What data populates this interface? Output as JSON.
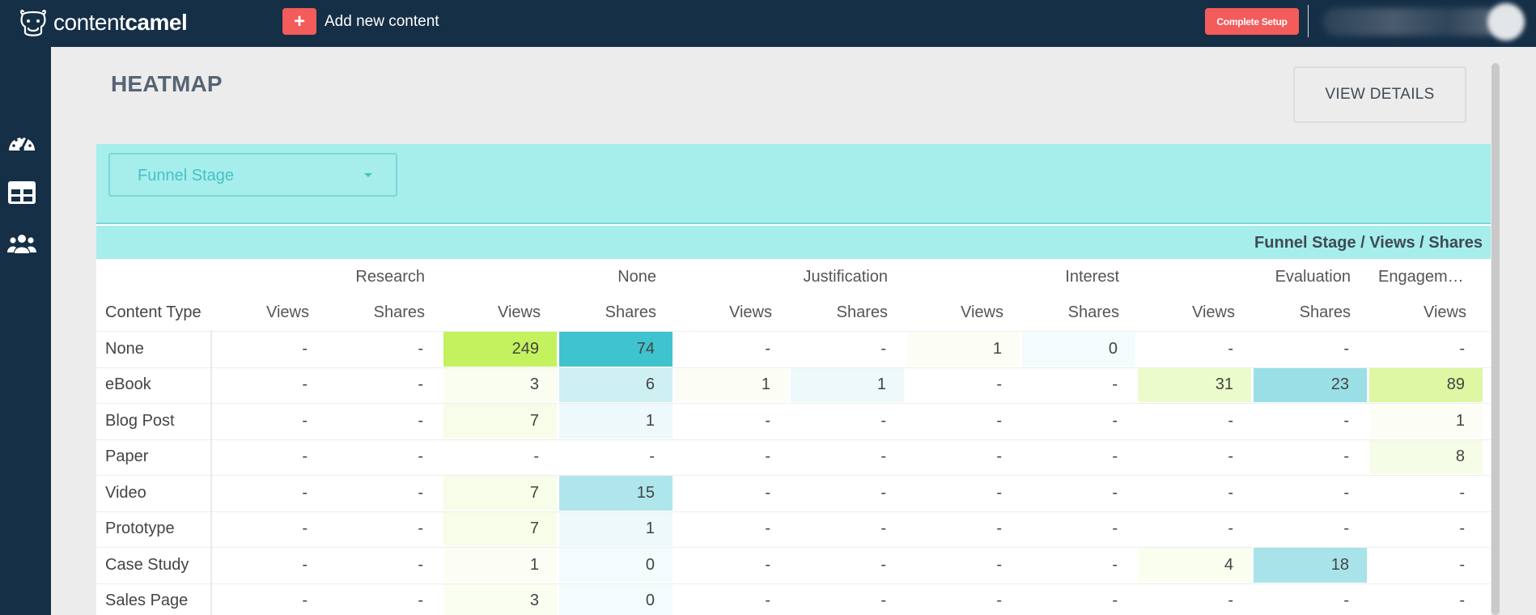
{
  "app": {
    "logo_text_light": "content",
    "logo_text_bold": "camel"
  },
  "topbar": {
    "add_label": "Add new content",
    "add_icon": "+",
    "setup_label": "Complete Setup"
  },
  "sidebar": {
    "items": [
      {
        "icon": "dashboard-gauge-icon"
      },
      {
        "icon": "table-icon"
      },
      {
        "icon": "users-icon"
      }
    ]
  },
  "page": {
    "title": "HEATMAP",
    "view_details": "VIEW DETAILS"
  },
  "filter": {
    "selected": "Funnel Stage"
  },
  "heatmap": {
    "caption": "Funnel Stage / Views / Shares",
    "row_header": "Content Type",
    "stages": [
      "Research",
      "None",
      "Justification",
      "Interest",
      "Evaluation",
      "Engagem…"
    ],
    "metrics": [
      "Views",
      "Shares",
      "Views",
      "Shares",
      "Views",
      "Shares",
      "Views",
      "Shares",
      "Views",
      "Shares",
      "Views"
    ],
    "rows": [
      {
        "label": "None",
        "values": [
          "-",
          "-",
          "249",
          "74",
          "-",
          "-",
          "1",
          "0",
          "-",
          "-",
          "-"
        ]
      },
      {
        "label": "eBook",
        "values": [
          "-",
          "-",
          "3",
          "6",
          "1",
          "1",
          "-",
          "-",
          "31",
          "23",
          "89"
        ]
      },
      {
        "label": "Blog Post",
        "values": [
          "-",
          "-",
          "7",
          "1",
          "-",
          "-",
          "-",
          "-",
          "-",
          "-",
          "1"
        ]
      },
      {
        "label": "Paper",
        "values": [
          "-",
          "-",
          "-",
          "-",
          "-",
          "-",
          "-",
          "-",
          "-",
          "-",
          "8"
        ]
      },
      {
        "label": "Video",
        "values": [
          "-",
          "-",
          "7",
          "15",
          "-",
          "-",
          "-",
          "-",
          "-",
          "-",
          "-"
        ]
      },
      {
        "label": "Prototype",
        "values": [
          "-",
          "-",
          "7",
          "1",
          "-",
          "-",
          "-",
          "-",
          "-",
          "-",
          "-"
        ]
      },
      {
        "label": "Case Study",
        "values": [
          "-",
          "-",
          "1",
          "0",
          "-",
          "-",
          "-",
          "-",
          "4",
          "18",
          "-"
        ]
      },
      {
        "label": "Sales Page",
        "values": [
          "-",
          "-",
          "3",
          "0",
          "-",
          "-",
          "-",
          "-",
          "-",
          "-",
          "-"
        ]
      }
    ],
    "colors": {
      "views_max": "#c4f15e",
      "shares_max": "#3fc3cf"
    }
  }
}
